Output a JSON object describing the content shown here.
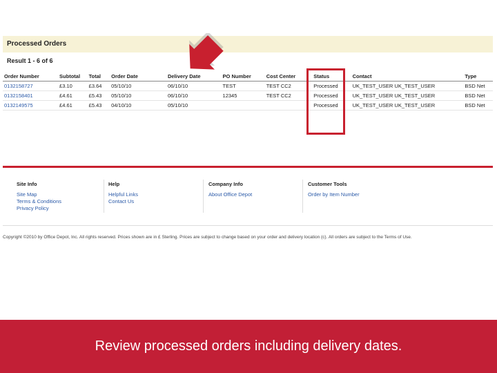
{
  "panel": {
    "title": "Processed Orders",
    "result_text": "Result 1 - 6 of 6"
  },
  "table": {
    "headers": [
      "Order Number",
      "Subtotal",
      "Total",
      "Order Date",
      "Delivery Date",
      "PO Number",
      "Cost Center",
      "Status",
      "Contact",
      "Type"
    ],
    "rows": [
      [
        "0132158727",
        "£3.10",
        "£3.64",
        "05/10/10",
        "06/10/10",
        "TEST",
        "TEST CC2",
        "Processed",
        "UK_TEST_USER UK_TEST_USER",
        "BSD Net"
      ],
      [
        "0132158401",
        "£4.61",
        "£5.43",
        "05/10/10",
        "06/10/10",
        "12345",
        "TEST CC2",
        "Processed",
        "UK_TEST_USER UK_TEST_USER",
        "BSD Net"
      ],
      [
        "0132149575",
        "£4.61",
        "£5.43",
        "04/10/10",
        "05/10/10",
        "",
        "",
        "Processed",
        "UK_TEST_USER UK_TEST_USER",
        "BSD Net"
      ]
    ]
  },
  "footer": {
    "site_info": {
      "title": "Site Info",
      "links": [
        "Site Map",
        "Terms & Conditions",
        "Privacy Policy"
      ]
    },
    "help": {
      "title": "Help",
      "links": [
        "Helpful Links",
        "Contact Us"
      ]
    },
    "company_info": {
      "title": "Company Info",
      "links": [
        "About Office Depot"
      ]
    },
    "customer_tools": {
      "title": "Customer Tools",
      "links": [
        "Order by Item Number"
      ]
    },
    "copyright": "Copyright ©2010 by Office Depot, Inc. All rights reserved. Prices shown are in £ Sterling. Prices are subject to change based on your order and delivery location (c). All orders are subject to the Terms of Use."
  },
  "caption": "Review processed orders including delivery dates.",
  "colors": {
    "accent": "#c21f36",
    "highlight": "#c8202f",
    "header_bg": "#f7f2d6",
    "link": "#2b5aa8"
  }
}
